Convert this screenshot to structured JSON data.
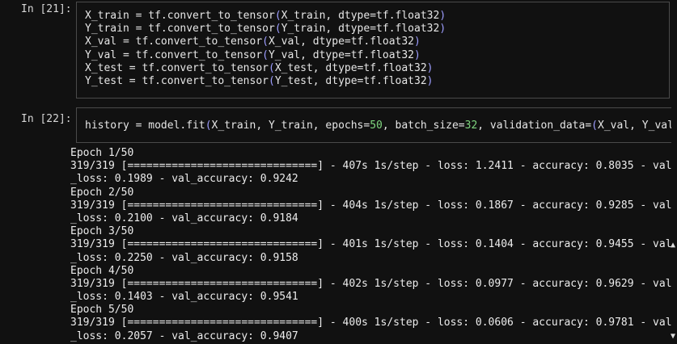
{
  "cells": [
    {
      "prompt": "In [21]:",
      "lines": [
        "X_train = tf.convert_to_tensor(X_train, dtype=tf.float32)",
        "Y_train = tf.convert_to_tensor(Y_train, dtype=tf.float32)",
        "X_val = tf.convert_to_tensor(X_val, dtype=tf.float32)",
        "Y_val = tf.convert_to_tensor(Y_val, dtype=tf.float32)",
        "X_test = tf.convert_to_tensor(X_test, dtype=tf.float32)",
        "Y_test = tf.convert_to_tensor(Y_test, dtype=tf.float32)"
      ]
    },
    {
      "prompt": "In [22]:",
      "lines": [
        "history = model.fit(X_train, Y_train, epochs=50, batch_size=32, validation_data=(X_val, Y_val"
      ]
    }
  ],
  "output": [
    "Epoch 1/50",
    "319/319 [==============================] - 407s 1s/step - loss: 1.2411 - accuracy: 0.8035 - val",
    "_loss: 0.1989 - val_accuracy: 0.9242",
    "Epoch 2/50",
    "319/319 [==============================] - 404s 1s/step - loss: 0.1867 - accuracy: 0.9285 - val",
    "_loss: 0.2100 - val_accuracy: 0.9184",
    "Epoch 3/50",
    "319/319 [==============================] - 401s 1s/step - loss: 0.1404 - accuracy: 0.9455 - val",
    "_loss: 0.2250 - val_accuracy: 0.9158",
    "Epoch 4/50",
    "319/319 [==============================] - 402s 1s/step - loss: 0.0977 - accuracy: 0.9629 - val",
    "_loss: 0.1403 - val_accuracy: 0.9541",
    "Epoch 5/50",
    "319/319 [==============================] - 400s 1s/step - loss: 0.0606 - accuracy: 0.9781 - val",
    "_loss: 0.2057 - val_accuracy: 0.9407"
  ],
  "icons": {
    "scroll_up": "scroll-up-arrow-icon",
    "scroll_down": "scroll-down-arrow-icon"
  },
  "colors": {
    "background": "#111111",
    "number_literal": "#7fd67f",
    "paren": "#9e9eff",
    "border": "#4a4a4a"
  }
}
